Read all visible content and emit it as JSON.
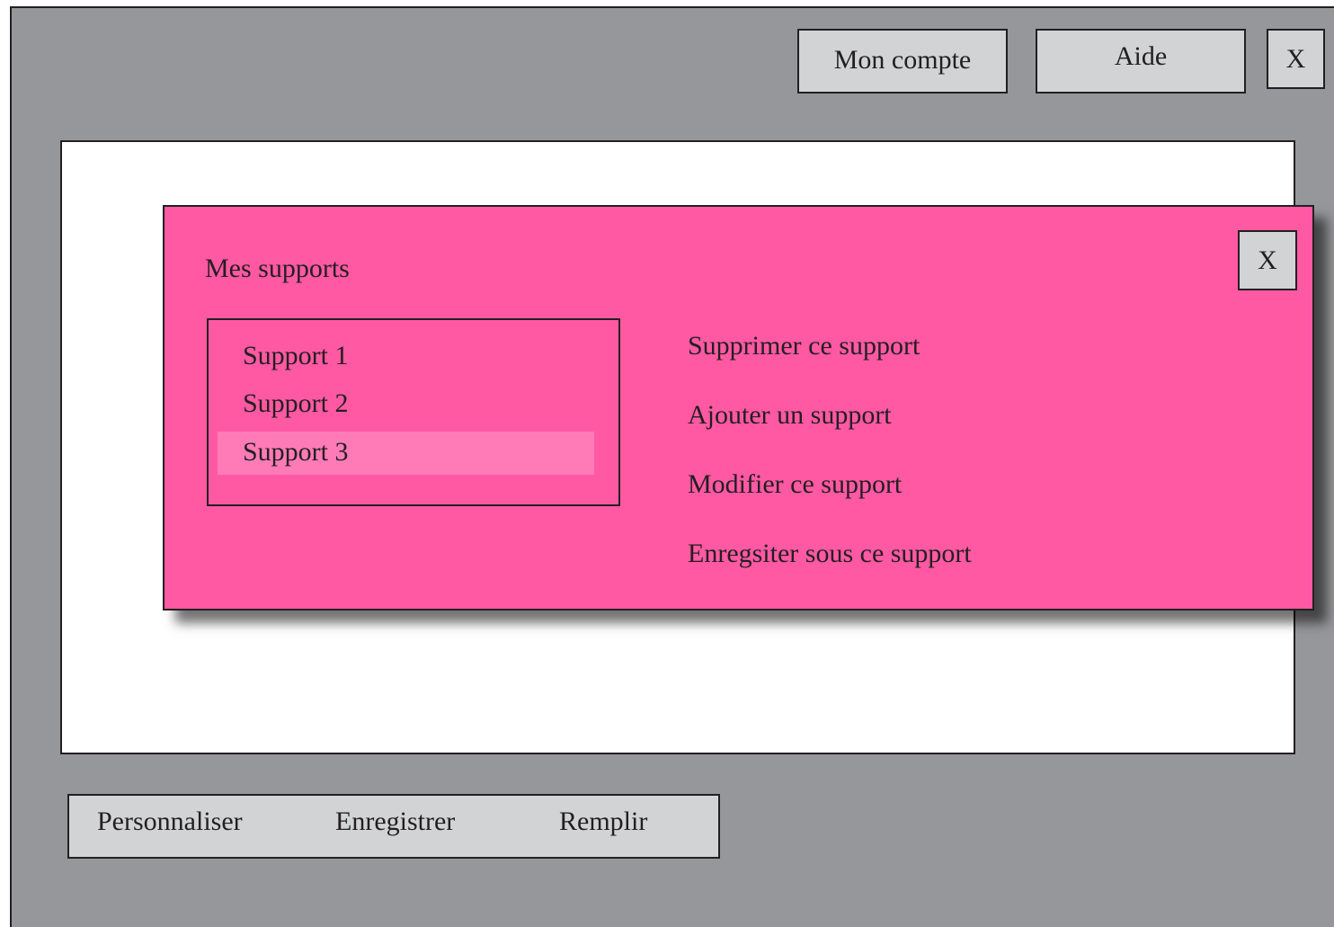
{
  "header": {
    "account_label": "Mon compte",
    "help_label": "Aide",
    "close_label": "X"
  },
  "toolbar": {
    "customize_label": "Personnaliser",
    "save_label": "Enregistrer",
    "fill_label": "Remplir"
  },
  "modal": {
    "title": "Mes supports",
    "close_label": "X",
    "supports": [
      {
        "label": "Support 1",
        "selected": false
      },
      {
        "label": "Support 2",
        "selected": false
      },
      {
        "label": "Support 3",
        "selected": true
      }
    ],
    "actions": [
      {
        "label": "Supprimer ce support"
      },
      {
        "label": "Ajouter un support"
      },
      {
        "label": "Modifier ce support"
      },
      {
        "label": "Enregsiter sous ce support"
      }
    ]
  },
  "colors": {
    "window_bg": "#96979a",
    "button_bg": "#d1d3d4",
    "modal_bg": "#ff59a4",
    "selected_bg": "#ff7bb7",
    "border": "#231f20"
  }
}
